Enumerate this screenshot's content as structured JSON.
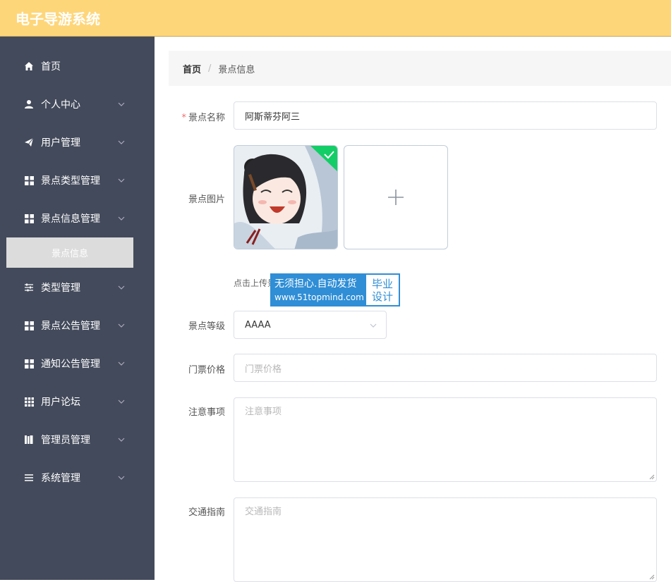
{
  "app": {
    "title": "电子导游系统"
  },
  "sidebar": {
    "items": [
      {
        "label": "首页",
        "icon": "home-icon",
        "has_children": false
      },
      {
        "label": "个人中心",
        "icon": "user-icon",
        "has_children": true
      },
      {
        "label": "用户管理",
        "icon": "send-icon",
        "has_children": true
      },
      {
        "label": "景点类型管理",
        "icon": "grid-icon",
        "has_children": true
      },
      {
        "label": "景点信息管理",
        "icon": "grid-icon",
        "has_children": true
      },
      {
        "label": "类型管理",
        "icon": "sliders-icon",
        "has_children": true
      },
      {
        "label": "景点公告管理",
        "icon": "grid-icon",
        "has_children": true
      },
      {
        "label": "通知公告管理",
        "icon": "grid-icon",
        "has_children": true
      },
      {
        "label": "用户论坛",
        "icon": "dots-grid-icon",
        "has_children": true
      },
      {
        "label": "管理员管理",
        "icon": "books-icon",
        "has_children": true
      },
      {
        "label": "系统管理",
        "icon": "list-icon",
        "has_children": true
      }
    ],
    "active_sub_item": "景点信息"
  },
  "breadcrumb": {
    "home": "首页",
    "separator": "/",
    "current": "景点信息"
  },
  "form": {
    "name": {
      "label": "景点名称",
      "required_mark": "*",
      "value": "阿斯蒂芬阿三"
    },
    "image": {
      "label": "景点图片",
      "upload_tip": "点击上传景"
    },
    "level": {
      "label": "景点等级",
      "value": "AAAA"
    },
    "price": {
      "label": "门票价格",
      "placeholder": "门票价格"
    },
    "notes": {
      "label": "注意事项",
      "placeholder": "注意事项"
    },
    "traffic": {
      "label": "交通指南",
      "placeholder": "交通指南"
    }
  },
  "watermark": {
    "line1": "无须担心.自动发货",
    "line2": "www.51topmind.com",
    "badge_line1": "毕业",
    "badge_line2": "设计"
  },
  "colors": {
    "topbar": "#fed67a",
    "sidebar": "#434a5b",
    "active_sub_item": "#dcdcdc",
    "required": "#f56c6c",
    "upload_success": "#13ce66",
    "watermark": "#2f8ed6"
  }
}
